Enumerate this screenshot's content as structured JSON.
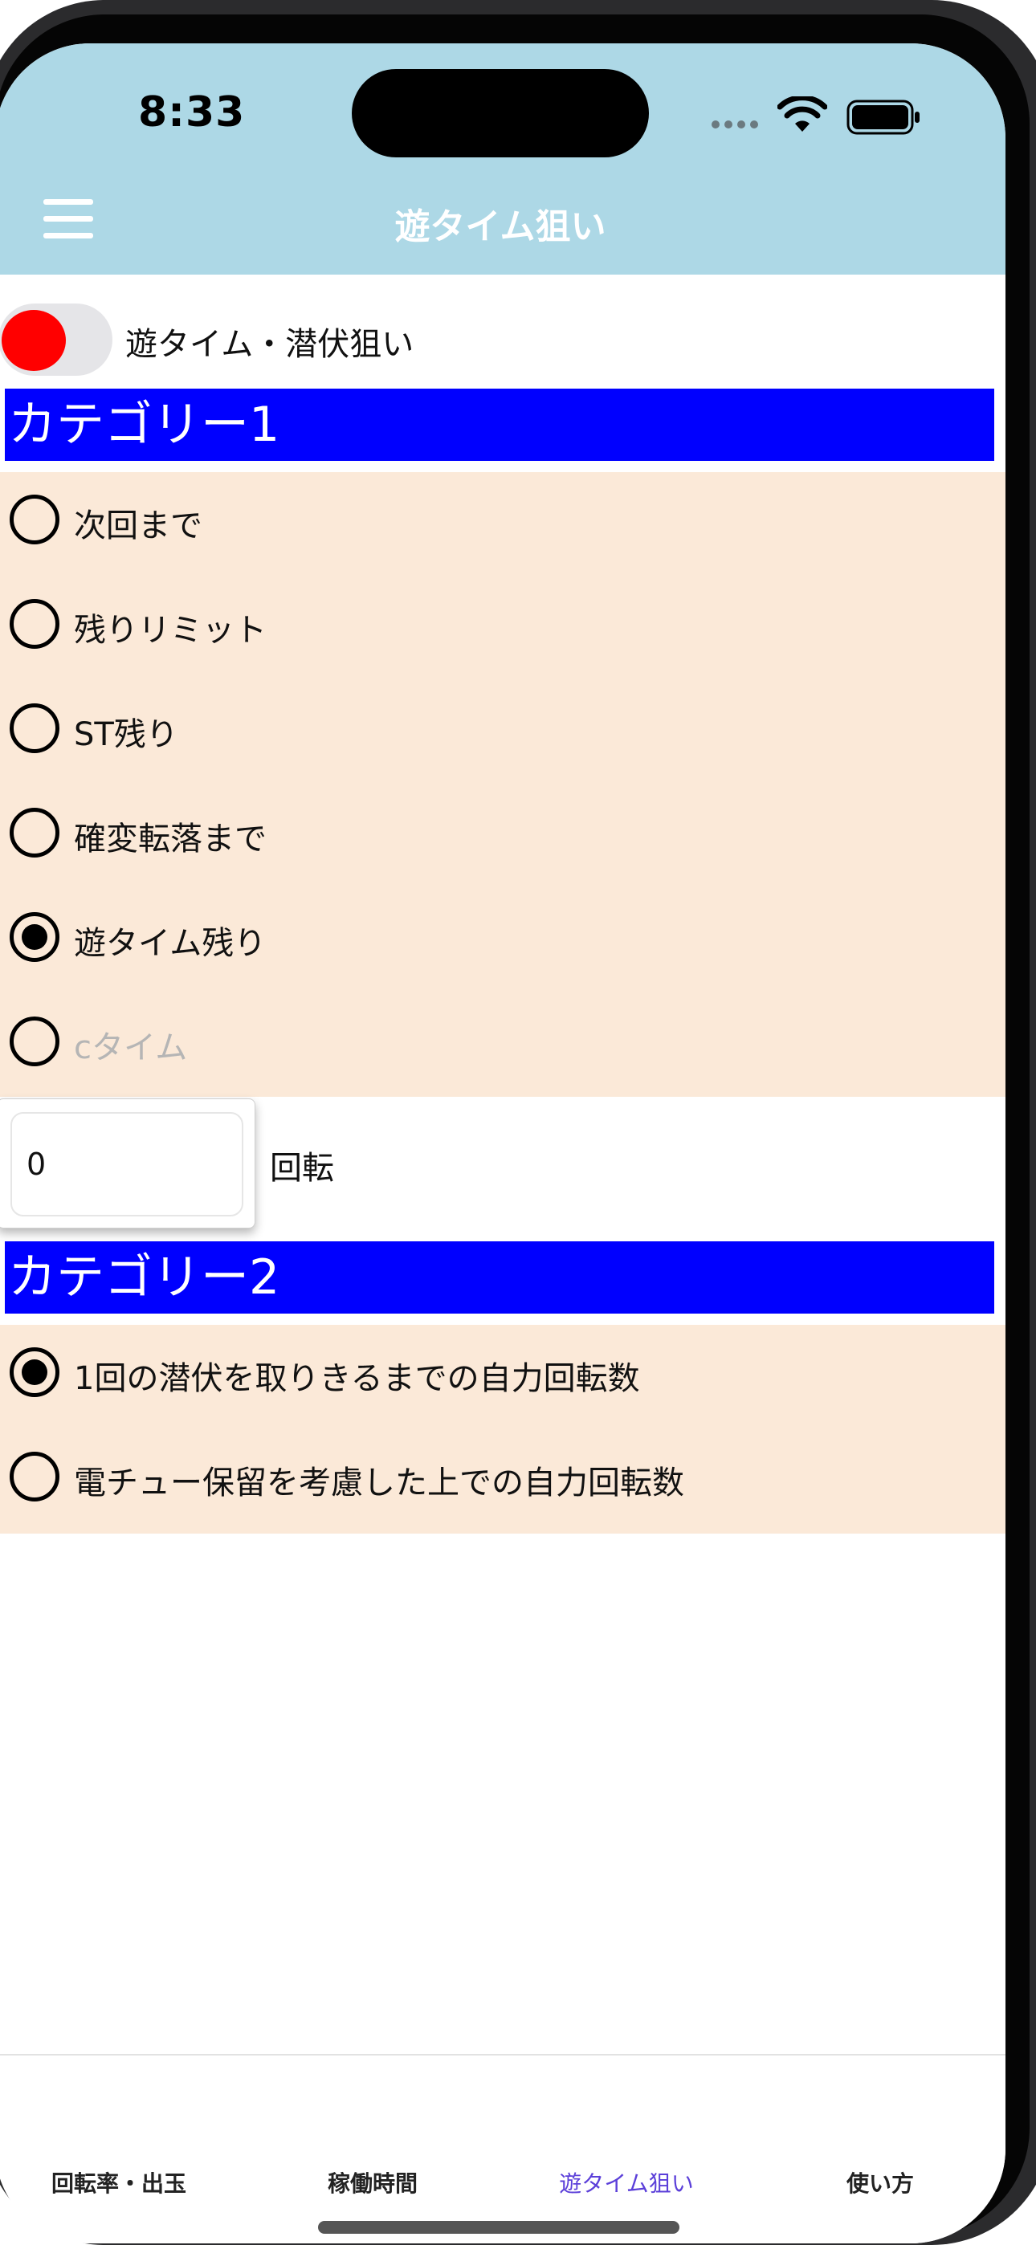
{
  "status_bar": {
    "time": "8:33"
  },
  "header": {
    "title": "遊タイム狙い"
  },
  "toggle": {
    "label": "遊タイム・潜伏狙い",
    "on": true,
    "knob_color": "#ff0000"
  },
  "category1": {
    "title": "カテゴリー1",
    "options": [
      {
        "label": "次回まで",
        "checked": false,
        "disabled": false
      },
      {
        "label": "残りリミット",
        "checked": false,
        "disabled": false
      },
      {
        "label": "ST残り",
        "checked": false,
        "disabled": false
      },
      {
        "label": "確変転落まで",
        "checked": false,
        "disabled": false
      },
      {
        "label": "遊タイム残り",
        "checked": true,
        "disabled": false
      },
      {
        "label": "cタイム",
        "checked": false,
        "disabled": true
      }
    ]
  },
  "spin_input": {
    "value": "0",
    "suffix": "回転"
  },
  "category2": {
    "title": "カテゴリー2",
    "options": [
      {
        "label": "1回の潜伏を取りきるまでの自力回転数",
        "checked": true
      },
      {
        "label": "電チュー保留を考慮した上での自力回転数",
        "checked": false
      }
    ]
  },
  "tabs": [
    {
      "label": "回転率・出玉",
      "active": false
    },
    {
      "label": "稼働時間",
      "active": false
    },
    {
      "label": "遊タイム狙い",
      "active": true
    },
    {
      "label": "使い方",
      "active": false
    }
  ],
  "colors": {
    "header_bg": "#add8e6",
    "category_bg": "#0000ff",
    "radio_block_bg": "#fbe9d8",
    "active_tab": "#5b3fd9"
  }
}
